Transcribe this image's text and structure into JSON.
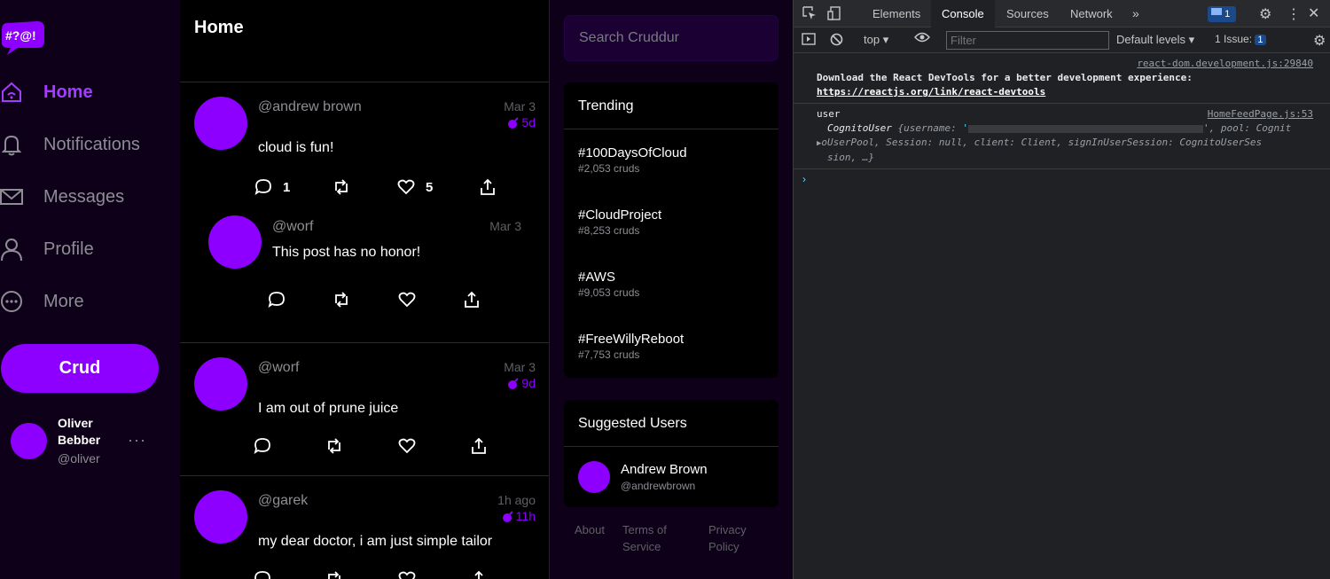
{
  "app": {
    "logo_text": "#?@!",
    "nav": [
      {
        "label": "Home",
        "icon": "home-icon"
      },
      {
        "label": "Notifications",
        "icon": "bell-icon"
      },
      {
        "label": "Messages",
        "icon": "mail-icon"
      },
      {
        "label": "Profile",
        "icon": "user-icon"
      },
      {
        "label": "More",
        "icon": "more-icon"
      }
    ],
    "crud_button": "Crud",
    "me": {
      "name": "Oliver Bebber",
      "handle": "@oliver",
      "more": "···"
    },
    "feed_title": "Home",
    "posts": [
      {
        "handle": "@andrew brown",
        "date": "Mar 3",
        "expires": "5d",
        "message": "cloud is fun!",
        "replies": "1",
        "likes": "5"
      },
      {
        "handle": "@worf",
        "date": "Mar 3",
        "message": "This post has no honor!"
      },
      {
        "handle": "@worf",
        "date": "Mar 3",
        "expires": "9d",
        "message": "I am out of prune juice"
      },
      {
        "handle": "@garek",
        "date": "1h ago",
        "expires": "11h",
        "message": "my dear doctor, i am just simple tailor"
      }
    ],
    "search_placeholder": "Search Cruddur",
    "trending": {
      "title": "Trending",
      "items": [
        {
          "tag": "#100DaysOfCloud",
          "count": "#2,053 cruds"
        },
        {
          "tag": "#CloudProject",
          "count": "#8,253 cruds"
        },
        {
          "tag": "#AWS",
          "count": "#9,053 cruds"
        },
        {
          "tag": "#FreeWillyReboot",
          "count": "#7,753 cruds"
        }
      ]
    },
    "suggested": {
      "title": "Suggested Users",
      "users": [
        {
          "name": "Andrew Brown",
          "handle": "@andrewbrown"
        }
      ]
    },
    "footer": {
      "about": "About",
      "terms": "Terms of Service",
      "privacy": "Privacy Policy"
    }
  },
  "devtools": {
    "tabs": [
      "Elements",
      "Console",
      "Sources",
      "Network"
    ],
    "active_tab": "Console",
    "messages_badge": "1",
    "context": "top",
    "filter_placeholder": "Filter",
    "levels": "Default levels",
    "issues_label": "1 Issue:",
    "issues_count": "1",
    "console": {
      "msg1_source": "react-dom.development.js:29840",
      "msg1_text": "Download the React DevTools for a better development experience: ",
      "msg1_link": "https://reactjs.org/link/react-devtools",
      "msg2_label": "user",
      "msg2_source": "HomeFeedPage.js:53",
      "msg2_class": "CognitoUser",
      "msg2_line1_key": "username",
      "msg2_line1_rest": "', pool: Cognit",
      "msg2_line2": "oUserPool, Session: null, client: Client, signInUserSession: CognitoUserSes",
      "msg2_line3": "sion, …}"
    }
  }
}
